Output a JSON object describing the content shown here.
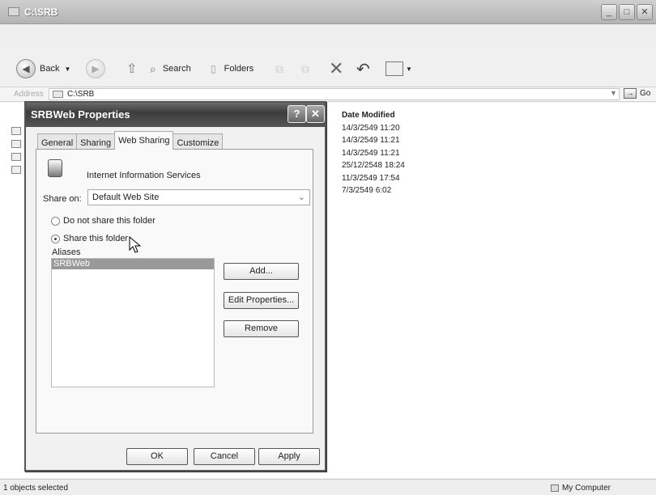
{
  "explorer": {
    "title": "C:\\SRB",
    "toolbar": {
      "back_label": "Back",
      "search_label": "Search",
      "folders_label": "Folders"
    },
    "address": {
      "label": "Address",
      "value": "C:\\SRB",
      "go_label": "Go"
    },
    "file_list": {
      "column_header": "Date Modified",
      "dates": [
        "14/3/2549 11:20",
        "14/3/2549 11:21",
        "14/3/2549 11:21",
        "25/12/2548 18:24",
        "11/3/2549 17:54",
        "7/3/2549 6:02"
      ]
    },
    "status": {
      "selection": "1 objects selected",
      "location": "My Computer"
    }
  },
  "dialog": {
    "title": "SRBWeb Properties",
    "help_glyph": "?",
    "close_glyph": "✕",
    "tabs": [
      "General",
      "Sharing",
      "Web Sharing",
      "Customize"
    ],
    "active_tab": "Web Sharing",
    "service_label": "Internet Information Services",
    "share_on_label": "Share on:",
    "share_on_value": "Default Web Site",
    "radio_do_not_share": "Do not share this folder",
    "radio_share": "Share this folder",
    "selected_radio": "share",
    "aliases_label": "Aliases",
    "aliases": [
      "SRBWeb"
    ],
    "buttons": {
      "add": "Add...",
      "edit_properties": "Edit Properties...",
      "remove": "Remove",
      "ok": "OK",
      "cancel": "Cancel",
      "apply": "Apply"
    }
  }
}
